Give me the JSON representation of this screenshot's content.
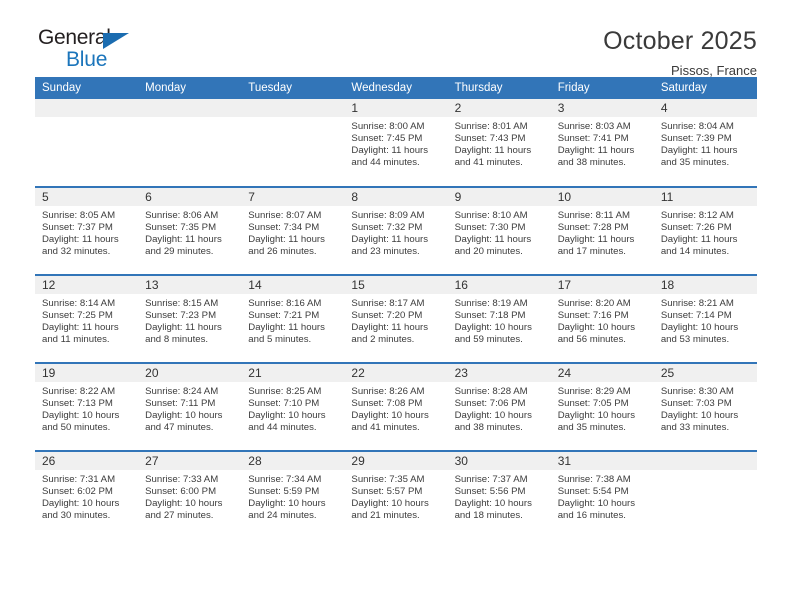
{
  "brand": {
    "name_part1": "General",
    "name_part2": "Blue",
    "triangle_color": "#1b6cb0",
    "blue_text_color": "#1b75bb"
  },
  "header": {
    "title": "October 2025",
    "location": "Pissos, France"
  },
  "theme": {
    "header_blue": "#3275b8",
    "daynum_band": "#f0f0f0",
    "text": "#3c3c3c"
  },
  "calendar": {
    "weekday_headers": [
      "Sunday",
      "Monday",
      "Tuesday",
      "Wednesday",
      "Thursday",
      "Friday",
      "Saturday"
    ],
    "weeks": [
      [
        {
          "day": "",
          "blank": true,
          "sunrise": "",
          "sunset": "",
          "daylight1": "",
          "daylight2": ""
        },
        {
          "day": "",
          "blank": true,
          "sunrise": "",
          "sunset": "",
          "daylight1": "",
          "daylight2": ""
        },
        {
          "day": "",
          "blank": true,
          "sunrise": "",
          "sunset": "",
          "daylight1": "",
          "daylight2": ""
        },
        {
          "day": "1",
          "sunrise": "Sunrise: 8:00 AM",
          "sunset": "Sunset: 7:45 PM",
          "daylight1": "Daylight: 11 hours",
          "daylight2": "and 44 minutes."
        },
        {
          "day": "2",
          "sunrise": "Sunrise: 8:01 AM",
          "sunset": "Sunset: 7:43 PM",
          "daylight1": "Daylight: 11 hours",
          "daylight2": "and 41 minutes."
        },
        {
          "day": "3",
          "sunrise": "Sunrise: 8:03 AM",
          "sunset": "Sunset: 7:41 PM",
          "daylight1": "Daylight: 11 hours",
          "daylight2": "and 38 minutes."
        },
        {
          "day": "4",
          "sunrise": "Sunrise: 8:04 AM",
          "sunset": "Sunset: 7:39 PM",
          "daylight1": "Daylight: 11 hours",
          "daylight2": "and 35 minutes."
        }
      ],
      [
        {
          "day": "5",
          "sunrise": "Sunrise: 8:05 AM",
          "sunset": "Sunset: 7:37 PM",
          "daylight1": "Daylight: 11 hours",
          "daylight2": "and 32 minutes."
        },
        {
          "day": "6",
          "sunrise": "Sunrise: 8:06 AM",
          "sunset": "Sunset: 7:35 PM",
          "daylight1": "Daylight: 11 hours",
          "daylight2": "and 29 minutes."
        },
        {
          "day": "7",
          "sunrise": "Sunrise: 8:07 AM",
          "sunset": "Sunset: 7:34 PM",
          "daylight1": "Daylight: 11 hours",
          "daylight2": "and 26 minutes."
        },
        {
          "day": "8",
          "sunrise": "Sunrise: 8:09 AM",
          "sunset": "Sunset: 7:32 PM",
          "daylight1": "Daylight: 11 hours",
          "daylight2": "and 23 minutes."
        },
        {
          "day": "9",
          "sunrise": "Sunrise: 8:10 AM",
          "sunset": "Sunset: 7:30 PM",
          "daylight1": "Daylight: 11 hours",
          "daylight2": "and 20 minutes."
        },
        {
          "day": "10",
          "sunrise": "Sunrise: 8:11 AM",
          "sunset": "Sunset: 7:28 PM",
          "daylight1": "Daylight: 11 hours",
          "daylight2": "and 17 minutes."
        },
        {
          "day": "11",
          "sunrise": "Sunrise: 8:12 AM",
          "sunset": "Sunset: 7:26 PM",
          "daylight1": "Daylight: 11 hours",
          "daylight2": "and 14 minutes."
        }
      ],
      [
        {
          "day": "12",
          "sunrise": "Sunrise: 8:14 AM",
          "sunset": "Sunset: 7:25 PM",
          "daylight1": "Daylight: 11 hours",
          "daylight2": "and 11 minutes."
        },
        {
          "day": "13",
          "sunrise": "Sunrise: 8:15 AM",
          "sunset": "Sunset: 7:23 PM",
          "daylight1": "Daylight: 11 hours",
          "daylight2": "and 8 minutes."
        },
        {
          "day": "14",
          "sunrise": "Sunrise: 8:16 AM",
          "sunset": "Sunset: 7:21 PM",
          "daylight1": "Daylight: 11 hours",
          "daylight2": "and 5 minutes."
        },
        {
          "day": "15",
          "sunrise": "Sunrise: 8:17 AM",
          "sunset": "Sunset: 7:20 PM",
          "daylight1": "Daylight: 11 hours",
          "daylight2": "and 2 minutes."
        },
        {
          "day": "16",
          "sunrise": "Sunrise: 8:19 AM",
          "sunset": "Sunset: 7:18 PM",
          "daylight1": "Daylight: 10 hours",
          "daylight2": "and 59 minutes."
        },
        {
          "day": "17",
          "sunrise": "Sunrise: 8:20 AM",
          "sunset": "Sunset: 7:16 PM",
          "daylight1": "Daylight: 10 hours",
          "daylight2": "and 56 minutes."
        },
        {
          "day": "18",
          "sunrise": "Sunrise: 8:21 AM",
          "sunset": "Sunset: 7:14 PM",
          "daylight1": "Daylight: 10 hours",
          "daylight2": "and 53 minutes."
        }
      ],
      [
        {
          "day": "19",
          "sunrise": "Sunrise: 8:22 AM",
          "sunset": "Sunset: 7:13 PM",
          "daylight1": "Daylight: 10 hours",
          "daylight2": "and 50 minutes."
        },
        {
          "day": "20",
          "sunrise": "Sunrise: 8:24 AM",
          "sunset": "Sunset: 7:11 PM",
          "daylight1": "Daylight: 10 hours",
          "daylight2": "and 47 minutes."
        },
        {
          "day": "21",
          "sunrise": "Sunrise: 8:25 AM",
          "sunset": "Sunset: 7:10 PM",
          "daylight1": "Daylight: 10 hours",
          "daylight2": "and 44 minutes."
        },
        {
          "day": "22",
          "sunrise": "Sunrise: 8:26 AM",
          "sunset": "Sunset: 7:08 PM",
          "daylight1": "Daylight: 10 hours",
          "daylight2": "and 41 minutes."
        },
        {
          "day": "23",
          "sunrise": "Sunrise: 8:28 AM",
          "sunset": "Sunset: 7:06 PM",
          "daylight1": "Daylight: 10 hours",
          "daylight2": "and 38 minutes."
        },
        {
          "day": "24",
          "sunrise": "Sunrise: 8:29 AM",
          "sunset": "Sunset: 7:05 PM",
          "daylight1": "Daylight: 10 hours",
          "daylight2": "and 35 minutes."
        },
        {
          "day": "25",
          "sunrise": "Sunrise: 8:30 AM",
          "sunset": "Sunset: 7:03 PM",
          "daylight1": "Daylight: 10 hours",
          "daylight2": "and 33 minutes."
        }
      ],
      [
        {
          "day": "26",
          "sunrise": "Sunrise: 7:31 AM",
          "sunset": "Sunset: 6:02 PM",
          "daylight1": "Daylight: 10 hours",
          "daylight2": "and 30 minutes."
        },
        {
          "day": "27",
          "sunrise": "Sunrise: 7:33 AM",
          "sunset": "Sunset: 6:00 PM",
          "daylight1": "Daylight: 10 hours",
          "daylight2": "and 27 minutes."
        },
        {
          "day": "28",
          "sunrise": "Sunrise: 7:34 AM",
          "sunset": "Sunset: 5:59 PM",
          "daylight1": "Daylight: 10 hours",
          "daylight2": "and 24 minutes."
        },
        {
          "day": "29",
          "sunrise": "Sunrise: 7:35 AM",
          "sunset": "Sunset: 5:57 PM",
          "daylight1": "Daylight: 10 hours",
          "daylight2": "and 21 minutes."
        },
        {
          "day": "30",
          "sunrise": "Sunrise: 7:37 AM",
          "sunset": "Sunset: 5:56 PM",
          "daylight1": "Daylight: 10 hours",
          "daylight2": "and 18 minutes."
        },
        {
          "day": "31",
          "sunrise": "Sunrise: 7:38 AM",
          "sunset": "Sunset: 5:54 PM",
          "daylight1": "Daylight: 10 hours",
          "daylight2": "and 16 minutes."
        },
        {
          "day": "",
          "blank": true,
          "sunrise": "",
          "sunset": "",
          "daylight1": "",
          "daylight2": ""
        }
      ]
    ]
  }
}
